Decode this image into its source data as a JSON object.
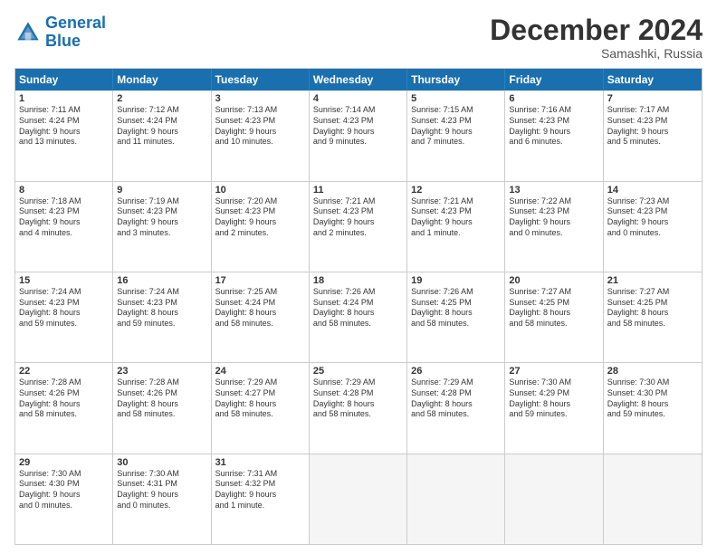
{
  "logo": {
    "line1": "General",
    "line2": "Blue"
  },
  "title": "December 2024",
  "location": "Samashki, Russia",
  "days": [
    "Sunday",
    "Monday",
    "Tuesday",
    "Wednesday",
    "Thursday",
    "Friday",
    "Saturday"
  ],
  "weeks": [
    [
      {
        "day": "1",
        "info": "Sunrise: 7:11 AM\nSunset: 4:24 PM\nDaylight: 9 hours\nand 13 minutes."
      },
      {
        "day": "2",
        "info": "Sunrise: 7:12 AM\nSunset: 4:24 PM\nDaylight: 9 hours\nand 11 minutes."
      },
      {
        "day": "3",
        "info": "Sunrise: 7:13 AM\nSunset: 4:23 PM\nDaylight: 9 hours\nand 10 minutes."
      },
      {
        "day": "4",
        "info": "Sunrise: 7:14 AM\nSunset: 4:23 PM\nDaylight: 9 hours\nand 9 minutes."
      },
      {
        "day": "5",
        "info": "Sunrise: 7:15 AM\nSunset: 4:23 PM\nDaylight: 9 hours\nand 7 minutes."
      },
      {
        "day": "6",
        "info": "Sunrise: 7:16 AM\nSunset: 4:23 PM\nDaylight: 9 hours\nand 6 minutes."
      },
      {
        "day": "7",
        "info": "Sunrise: 7:17 AM\nSunset: 4:23 PM\nDaylight: 9 hours\nand 5 minutes."
      }
    ],
    [
      {
        "day": "8",
        "info": "Sunrise: 7:18 AM\nSunset: 4:23 PM\nDaylight: 9 hours\nand 4 minutes."
      },
      {
        "day": "9",
        "info": "Sunrise: 7:19 AM\nSunset: 4:23 PM\nDaylight: 9 hours\nand 3 minutes."
      },
      {
        "day": "10",
        "info": "Sunrise: 7:20 AM\nSunset: 4:23 PM\nDaylight: 9 hours\nand 2 minutes."
      },
      {
        "day": "11",
        "info": "Sunrise: 7:21 AM\nSunset: 4:23 PM\nDaylight: 9 hours\nand 2 minutes."
      },
      {
        "day": "12",
        "info": "Sunrise: 7:21 AM\nSunset: 4:23 PM\nDaylight: 9 hours\nand 1 minute."
      },
      {
        "day": "13",
        "info": "Sunrise: 7:22 AM\nSunset: 4:23 PM\nDaylight: 9 hours\nand 0 minutes."
      },
      {
        "day": "14",
        "info": "Sunrise: 7:23 AM\nSunset: 4:23 PM\nDaylight: 9 hours\nand 0 minutes."
      }
    ],
    [
      {
        "day": "15",
        "info": "Sunrise: 7:24 AM\nSunset: 4:23 PM\nDaylight: 8 hours\nand 59 minutes."
      },
      {
        "day": "16",
        "info": "Sunrise: 7:24 AM\nSunset: 4:23 PM\nDaylight: 8 hours\nand 59 minutes."
      },
      {
        "day": "17",
        "info": "Sunrise: 7:25 AM\nSunset: 4:24 PM\nDaylight: 8 hours\nand 58 minutes."
      },
      {
        "day": "18",
        "info": "Sunrise: 7:26 AM\nSunset: 4:24 PM\nDaylight: 8 hours\nand 58 minutes."
      },
      {
        "day": "19",
        "info": "Sunrise: 7:26 AM\nSunset: 4:25 PM\nDaylight: 8 hours\nand 58 minutes."
      },
      {
        "day": "20",
        "info": "Sunrise: 7:27 AM\nSunset: 4:25 PM\nDaylight: 8 hours\nand 58 minutes."
      },
      {
        "day": "21",
        "info": "Sunrise: 7:27 AM\nSunset: 4:25 PM\nDaylight: 8 hours\nand 58 minutes."
      }
    ],
    [
      {
        "day": "22",
        "info": "Sunrise: 7:28 AM\nSunset: 4:26 PM\nDaylight: 8 hours\nand 58 minutes."
      },
      {
        "day": "23",
        "info": "Sunrise: 7:28 AM\nSunset: 4:26 PM\nDaylight: 8 hours\nand 58 minutes."
      },
      {
        "day": "24",
        "info": "Sunrise: 7:29 AM\nSunset: 4:27 PM\nDaylight: 8 hours\nand 58 minutes."
      },
      {
        "day": "25",
        "info": "Sunrise: 7:29 AM\nSunset: 4:28 PM\nDaylight: 8 hours\nand 58 minutes."
      },
      {
        "day": "26",
        "info": "Sunrise: 7:29 AM\nSunset: 4:28 PM\nDaylight: 8 hours\nand 58 minutes."
      },
      {
        "day": "27",
        "info": "Sunrise: 7:30 AM\nSunset: 4:29 PM\nDaylight: 8 hours\nand 59 minutes."
      },
      {
        "day": "28",
        "info": "Sunrise: 7:30 AM\nSunset: 4:30 PM\nDaylight: 8 hours\nand 59 minutes."
      }
    ],
    [
      {
        "day": "29",
        "info": "Sunrise: 7:30 AM\nSunset: 4:30 PM\nDaylight: 9 hours\nand 0 minutes."
      },
      {
        "day": "30",
        "info": "Sunrise: 7:30 AM\nSunset: 4:31 PM\nDaylight: 9 hours\nand 0 minutes."
      },
      {
        "day": "31",
        "info": "Sunrise: 7:31 AM\nSunset: 4:32 PM\nDaylight: 9 hours\nand 1 minute."
      },
      {
        "day": "",
        "info": ""
      },
      {
        "day": "",
        "info": ""
      },
      {
        "day": "",
        "info": ""
      },
      {
        "day": "",
        "info": ""
      }
    ]
  ]
}
